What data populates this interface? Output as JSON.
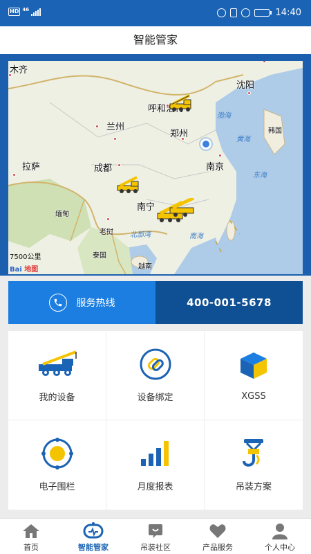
{
  "status_bar": {
    "hd": "HD",
    "network": "46",
    "time": "14:40",
    "battery_level": 0.45
  },
  "title": "智能管家",
  "map": {
    "cities": [
      "木齐",
      "呼和浩特",
      "沈阳",
      "兰州",
      "郑州",
      "韩国",
      "拉萨",
      "成都",
      "南京",
      "南宁",
      "缅甸",
      "老挝",
      "泰国",
      "越南"
    ],
    "seas": [
      "渤海",
      "黄海",
      "东海",
      "北部湾",
      "南海"
    ],
    "scale_label": "500公里",
    "scale_under": "7",
    "logo_bai": "Bai",
    "logo_du": "地图"
  },
  "hotline": {
    "label": "服务热线",
    "number": "400-001-5678"
  },
  "grid": [
    {
      "label": "我的设备",
      "icon": "crane-truck-icon"
    },
    {
      "label": "设备绑定",
      "icon": "link-icon"
    },
    {
      "label": "XGSS",
      "icon": "cube-icon"
    },
    {
      "label": "电子围栏",
      "icon": "geofence-icon"
    },
    {
      "label": "月度报表",
      "icon": "bar-chart-icon"
    },
    {
      "label": "吊装方案",
      "icon": "hook-icon"
    }
  ],
  "tabs": [
    {
      "label": "首页",
      "icon": "home-icon",
      "active": false
    },
    {
      "label": "智能管家",
      "icon": "robot-icon",
      "active": true
    },
    {
      "label": "吊装社区",
      "icon": "community-icon",
      "active": false
    },
    {
      "label": "产品服务",
      "icon": "heart-icon",
      "active": false
    },
    {
      "label": "个人中心",
      "icon": "person-icon",
      "active": false
    }
  ],
  "colors": {
    "primary": "#1b63b4",
    "hotline_left": "#1c7ee0",
    "hotline_right": "#0f4f94",
    "accent_yellow": "#f5c400"
  }
}
